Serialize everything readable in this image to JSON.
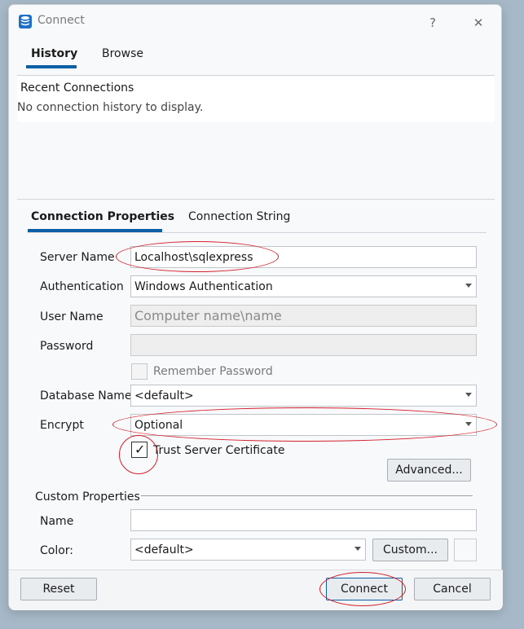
{
  "window": {
    "title": "Connect",
    "help_glyph": "?",
    "close_glyph": "✕"
  },
  "top_tabs": [
    {
      "label": "History",
      "active": true
    },
    {
      "label": "Browse",
      "active": false
    }
  ],
  "history": {
    "heading": "Recent Connections",
    "empty_text": "No connection history to display."
  },
  "conn_tabs": [
    {
      "label": "Connection Properties",
      "active": true
    },
    {
      "label": "Connection String",
      "active": false
    }
  ],
  "form": {
    "server_name": {
      "label": "Server Name",
      "value": "Localhost\\sqlexpress"
    },
    "authentication": {
      "label": "Authentication",
      "value": "Windows Authentication"
    },
    "user_name": {
      "label": "User Name",
      "placeholder": "Computer name\\name"
    },
    "password": {
      "label": "Password",
      "value": ""
    },
    "remember_password": {
      "label": "Remember Password",
      "checked": false
    },
    "database_name": {
      "label": "Database Name",
      "value": "<default>"
    },
    "encrypt": {
      "label": "Encrypt",
      "value": "Optional"
    },
    "trust_server_certificate": {
      "label": "Trust Server Certificate",
      "checked": true,
      "check_glyph": "✓"
    },
    "advanced_button": "Advanced..."
  },
  "custom_properties": {
    "heading": "Custom Properties",
    "name": {
      "label": "Name",
      "value": ""
    },
    "color": {
      "label": "Color:",
      "value": "<default>"
    },
    "custom_button": "Custom..."
  },
  "footer": {
    "reset": "Reset",
    "connect": "Connect",
    "cancel": "Cancel"
  },
  "colors": {
    "accent": "#0b5fa5",
    "annotation": "#d4202a"
  }
}
